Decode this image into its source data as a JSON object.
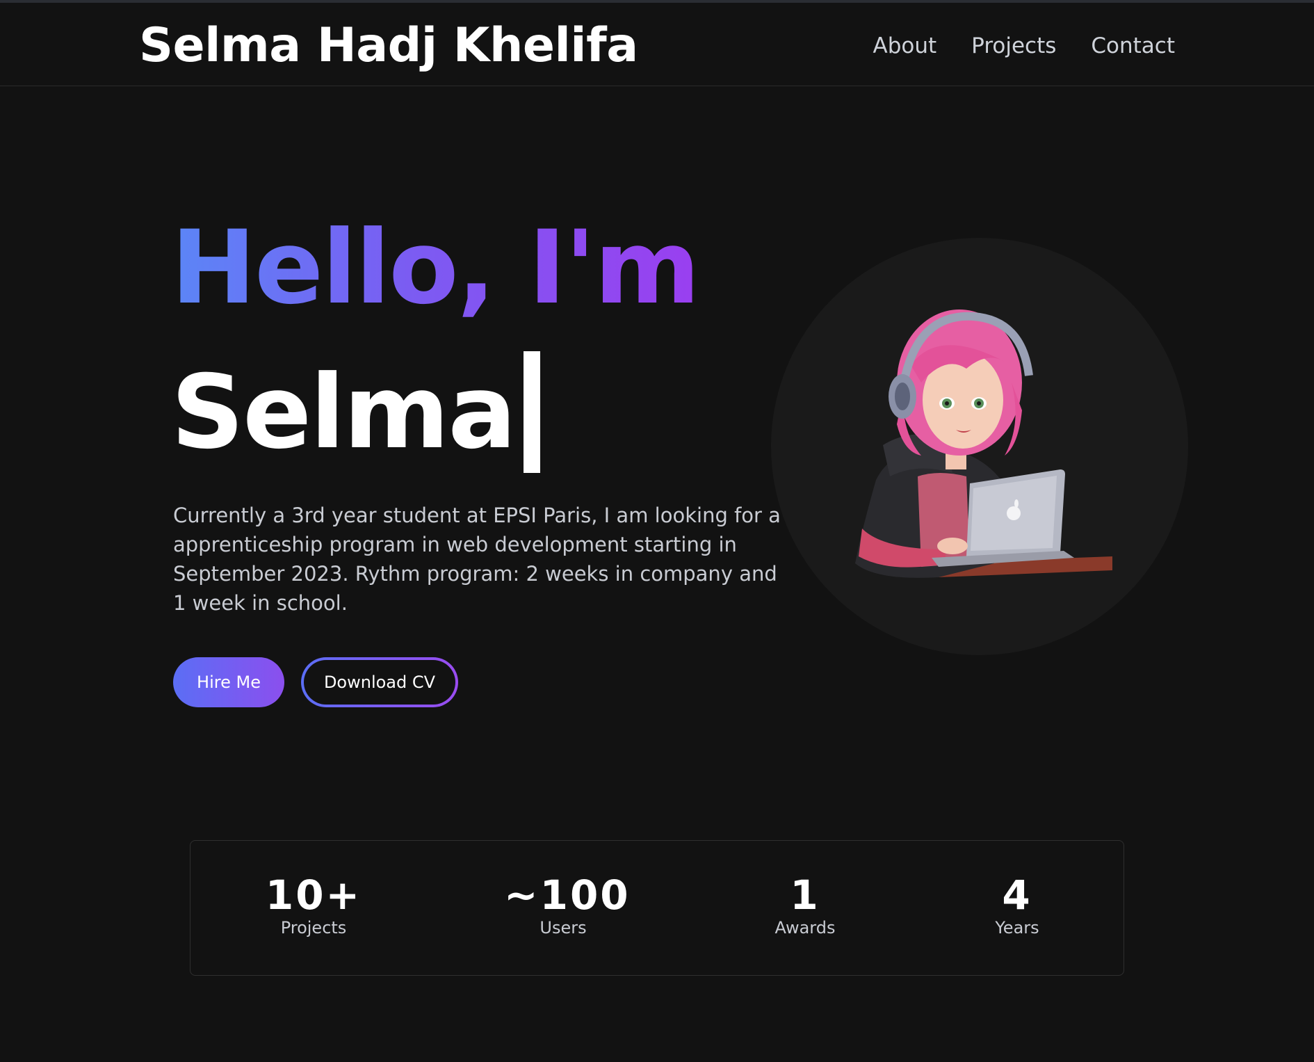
{
  "header": {
    "brand": "Selma Hadj Khelifa",
    "nav": [
      "About",
      "Projects",
      "Contact"
    ]
  },
  "hero": {
    "greeting": "Hello, I'm",
    "name": "Selma",
    "description": "Currently a 3rd year student at EPSI Paris, I am looking for a apprenticeship program in web development starting in September 2023. Rythm program: 2 weeks in company and 1 week in school.",
    "hire_label": "Hire Me",
    "cv_label": "Download CV"
  },
  "stats": [
    {
      "value": "10+",
      "label": "Projects"
    },
    {
      "value": "~100",
      "label": "Users"
    },
    {
      "value": "1",
      "label": "Awards"
    },
    {
      "value": "4",
      "label": "Years"
    }
  ],
  "colors": {
    "background": "#121212",
    "gradient_start": "#5b86f7",
    "gradient_end": "#9a3ff0",
    "text_muted": "#c9ccd3"
  }
}
